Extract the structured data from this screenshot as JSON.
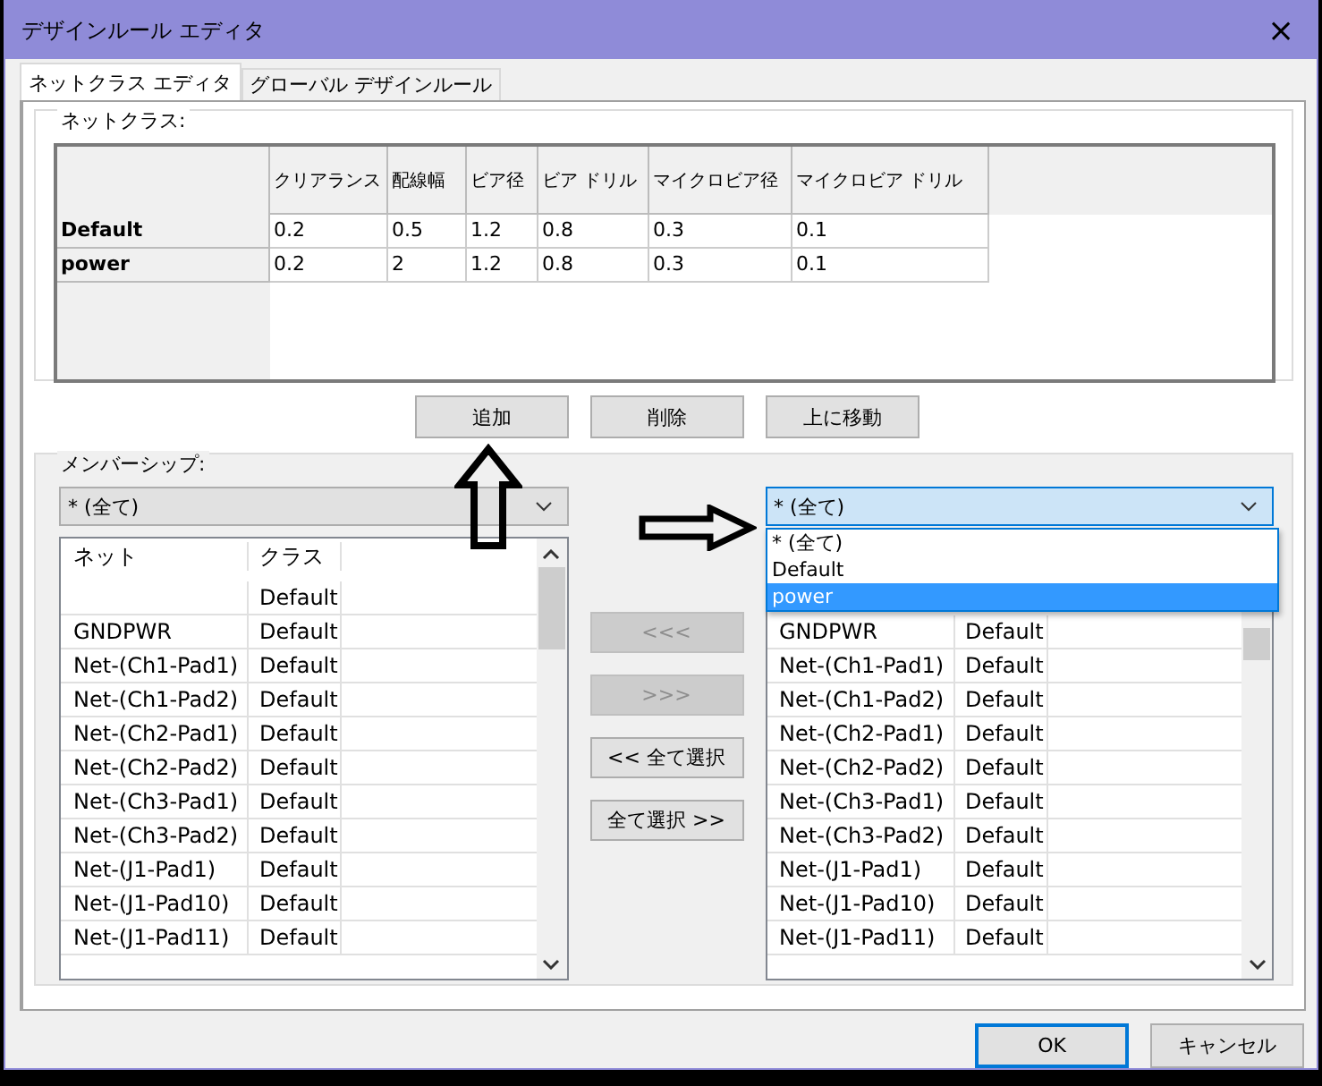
{
  "window": {
    "title": "デザインルール エディタ",
    "close": "×"
  },
  "tabs": [
    {
      "label": "ネットクラス エディタ",
      "selected": true
    },
    {
      "label": "グローバル デザインルール",
      "selected": false
    }
  ],
  "netclasses": {
    "label": "ネットクラス:",
    "columns": [
      "クリアランス",
      "配線幅",
      "ビア径",
      "ビア ドリル",
      "マイクロビア径",
      "マイクロビア ドリル"
    ],
    "rows": [
      {
        "name": "Default",
        "values": [
          "0.2",
          "0.5",
          "1.2",
          "0.8",
          "0.3",
          "0.1"
        ]
      },
      {
        "name": "power",
        "values": [
          "0.2",
          "2",
          "1.2",
          "0.8",
          "0.3",
          "0.1"
        ]
      }
    ],
    "buttons": [
      "追加",
      "削除",
      "上に移動"
    ]
  },
  "membership": {
    "label": "メンバーシップ:",
    "left": {
      "filter": "* (全て)",
      "columns": [
        "ネット",
        "クラス"
      ],
      "rows": [
        {
          "class": "Default"
        },
        {
          "net": "GNDPWR",
          "class": "Default"
        },
        {
          "net": "Net-(Ch1-Pad1)",
          "class": "Default"
        },
        {
          "net": "Net-(Ch1-Pad2)",
          "class": "Default"
        },
        {
          "net": "Net-(Ch2-Pad1)",
          "class": "Default"
        },
        {
          "net": "Net-(Ch2-Pad2)",
          "class": "Default"
        },
        {
          "net": "Net-(Ch3-Pad1)",
          "class": "Default"
        },
        {
          "net": "Net-(Ch3-Pad2)",
          "class": "Default"
        },
        {
          "net": "Net-(J1-Pad1)",
          "class": "Default"
        },
        {
          "net": "Net-(J1-Pad10)",
          "class": "Default"
        },
        {
          "net": "Net-(J1-Pad11)",
          "class": "Default"
        }
      ]
    },
    "move_buttons": [
      {
        "label": "<<<",
        "disabled": true
      },
      {
        "label": ">>>",
        "disabled": true
      },
      {
        "label": "<< 全て選択",
        "disabled": false
      },
      {
        "label": "全て選択 >>",
        "disabled": false
      }
    ],
    "right": {
      "filter": "* (全て)",
      "dropdown": [
        {
          "label": "* (全て)",
          "selected": false
        },
        {
          "label": "Default",
          "selected": false
        },
        {
          "label": "power",
          "selected": true
        }
      ],
      "rows": [
        {
          "net": "GNDPWR",
          "class": "Default"
        },
        {
          "net": "Net-(Ch1-Pad1)",
          "class": "Default"
        },
        {
          "net": "Net-(Ch1-Pad2)",
          "class": "Default"
        },
        {
          "net": "Net-(Ch2-Pad1)",
          "class": "Default"
        },
        {
          "net": "Net-(Ch2-Pad2)",
          "class": "Default"
        },
        {
          "net": "Net-(Ch3-Pad1)",
          "class": "Default"
        },
        {
          "net": "Net-(Ch3-Pad2)",
          "class": "Default"
        },
        {
          "net": "Net-(J1-Pad1)",
          "class": "Default"
        },
        {
          "net": "Net-(J1-Pad10)",
          "class": "Default"
        },
        {
          "net": "Net-(J1-Pad11)",
          "class": "Default"
        }
      ]
    }
  },
  "footer_buttons": [
    {
      "label": "OK",
      "focused": true
    },
    {
      "label": "キャンセル",
      "focused": false
    }
  ]
}
